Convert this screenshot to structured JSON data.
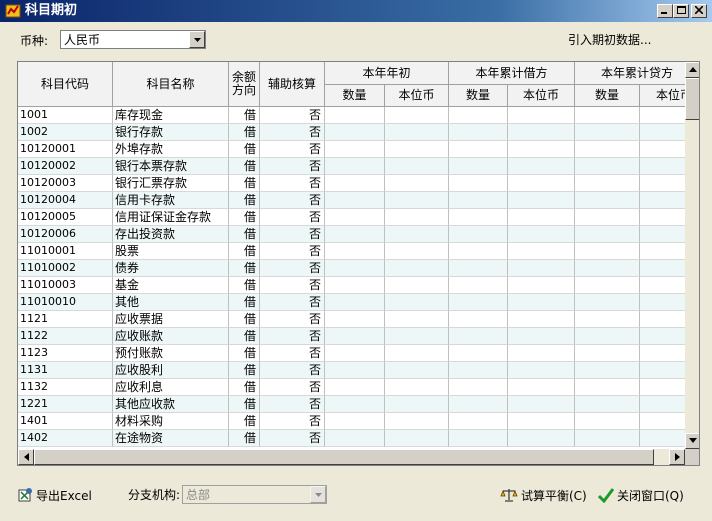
{
  "window": {
    "title": "科目期初"
  },
  "toolbar": {
    "currency_label": "币种:",
    "currency_value": "人民币",
    "import_label": "引入期初数据..."
  },
  "grid": {
    "headers": {
      "code": "科目代码",
      "name": "科目名称",
      "direction_1": "余额",
      "direction_2": "方向",
      "aux": "辅助核算",
      "group1": "本年年初",
      "group2": "本年累计借方",
      "group3": "本年累计贷方",
      "qty": "数量",
      "base": "本位币"
    },
    "rows": [
      {
        "code": "1001",
        "name": "库存现金",
        "dir": "借",
        "aux": "否"
      },
      {
        "code": "1002",
        "name": "银行存款",
        "dir": "借",
        "aux": "否"
      },
      {
        "code": "10120001",
        "name": "外埠存款",
        "dir": "借",
        "aux": "否"
      },
      {
        "code": "10120002",
        "name": "银行本票存款",
        "dir": "借",
        "aux": "否"
      },
      {
        "code": "10120003",
        "name": "银行汇票存款",
        "dir": "借",
        "aux": "否"
      },
      {
        "code": "10120004",
        "name": "信用卡存款",
        "dir": "借",
        "aux": "否"
      },
      {
        "code": "10120005",
        "name": "信用证保证金存款",
        "dir": "借",
        "aux": "否"
      },
      {
        "code": "10120006",
        "name": "存出投资款",
        "dir": "借",
        "aux": "否"
      },
      {
        "code": "11010001",
        "name": "股票",
        "dir": "借",
        "aux": "否"
      },
      {
        "code": "11010002",
        "name": "债券",
        "dir": "借",
        "aux": "否"
      },
      {
        "code": "11010003",
        "name": "基金",
        "dir": "借",
        "aux": "否"
      },
      {
        "code": "11010010",
        "name": "其他",
        "dir": "借",
        "aux": "否"
      },
      {
        "code": "1121",
        "name": "应收票据",
        "dir": "借",
        "aux": "否"
      },
      {
        "code": "1122",
        "name": "应收账款",
        "dir": "借",
        "aux": "否"
      },
      {
        "code": "1123",
        "name": "预付账款",
        "dir": "借",
        "aux": "否"
      },
      {
        "code": "1131",
        "name": "应收股利",
        "dir": "借",
        "aux": "否"
      },
      {
        "code": "1132",
        "name": "应收利息",
        "dir": "借",
        "aux": "否"
      },
      {
        "code": "1221",
        "name": "其他应收款",
        "dir": "借",
        "aux": "否"
      },
      {
        "code": "1401",
        "name": "材料采购",
        "dir": "借",
        "aux": "否"
      },
      {
        "code": "1402",
        "name": "在途物资",
        "dir": "借",
        "aux": "否"
      }
    ]
  },
  "bottom": {
    "export_label": "导出Excel",
    "branch_label": "分支机构:",
    "branch_value": "总部",
    "trial_balance_label": "试算平衡(C)",
    "close_label": "关闭窗口(Q)"
  },
  "icons": {
    "app": "ledger-app-icon",
    "export": "excel-export-icon",
    "trial_balance": "balance-scale-icon",
    "close": "green-check-icon"
  }
}
